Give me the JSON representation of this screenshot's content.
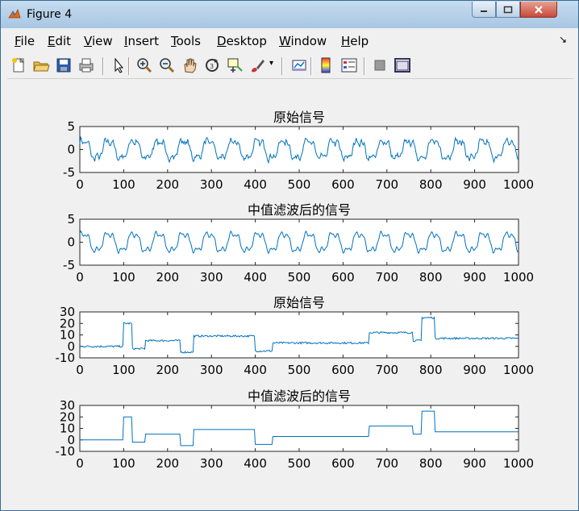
{
  "window": {
    "title": "Figure 4"
  },
  "menu": [
    {
      "key": "F",
      "rest": "ile"
    },
    {
      "key": "E",
      "rest": "dit"
    },
    {
      "key": "V",
      "rest": "iew"
    },
    {
      "key": "I",
      "rest": "nsert"
    },
    {
      "key": "T",
      "rest": "ools"
    },
    {
      "key": "D",
      "rest": "esktop"
    },
    {
      "key": "W",
      "rest": "indow"
    },
    {
      "key": "H",
      "rest": "elp"
    }
  ],
  "toolbar_icons": [
    "new-figure-icon",
    "open-file-icon",
    "save-icon",
    "print-icon",
    "pointer-icon",
    "zoom-in-icon",
    "zoom-out-icon",
    "pan-icon",
    "rotate-3d-icon",
    "data-cursor-icon",
    "brush-icon",
    "link-plot-icon",
    "colorbar-icon",
    "legend-icon",
    "hide-plot-tools-icon",
    "show-plot-tools-icon"
  ],
  "colors": {
    "line": "#0072bd",
    "axes_bg": "#ffffff",
    "figure_bg": "#f0f0f0"
  },
  "chart_data": [
    {
      "type": "line",
      "title": "原始信号",
      "xlim": [
        0,
        1000
      ],
      "ylim": [
        -5,
        5
      ],
      "xticks": [
        0,
        100,
        200,
        300,
        400,
        500,
        600,
        700,
        800,
        900,
        1000
      ],
      "yticks": [
        -5,
        0,
        5
      ],
      "signal": "periodic",
      "noisy": true
    },
    {
      "type": "line",
      "title": "中值滤波后的信号",
      "xlim": [
        0,
        1000
      ],
      "ylim": [
        -5,
        5
      ],
      "xticks": [
        0,
        100,
        200,
        300,
        400,
        500,
        600,
        700,
        800,
        900,
        1000
      ],
      "yticks": [
        -5,
        0,
        5
      ],
      "signal": "periodic",
      "noisy": false
    },
    {
      "type": "line",
      "title": "原始信号",
      "xlim": [
        0,
        1000
      ],
      "ylim": [
        -10,
        30
      ],
      "xticks": [
        0,
        100,
        200,
        300,
        400,
        500,
        600,
        700,
        800,
        900,
        1000
      ],
      "yticks": [
        -10,
        0,
        10,
        20,
        30
      ],
      "signal": "step",
      "noisy": true,
      "segments": [
        [
          0,
          100,
          0
        ],
        [
          100,
          120,
          20
        ],
        [
          120,
          150,
          -2
        ],
        [
          150,
          230,
          5
        ],
        [
          230,
          260,
          -5
        ],
        [
          260,
          400,
          9
        ],
        [
          400,
          440,
          -4
        ],
        [
          440,
          660,
          3
        ],
        [
          660,
          760,
          12
        ],
        [
          760,
          780,
          5
        ],
        [
          780,
          810,
          25
        ],
        [
          810,
          1000,
          7
        ]
      ]
    },
    {
      "type": "line",
      "title": "中值滤波后的信号",
      "xlim": [
        0,
        1000
      ],
      "ylim": [
        -10,
        30
      ],
      "xticks": [
        0,
        100,
        200,
        300,
        400,
        500,
        600,
        700,
        800,
        900,
        1000
      ],
      "yticks": [
        -10,
        0,
        10,
        20,
        30
      ],
      "signal": "step",
      "noisy": false,
      "segments": [
        [
          0,
          100,
          0
        ],
        [
          100,
          120,
          20
        ],
        [
          120,
          150,
          -2
        ],
        [
          150,
          230,
          5
        ],
        [
          230,
          260,
          -5
        ],
        [
          260,
          400,
          9
        ],
        [
          400,
          440,
          -4
        ],
        [
          440,
          660,
          3
        ],
        [
          660,
          760,
          12
        ],
        [
          760,
          780,
          5
        ],
        [
          780,
          810,
          25
        ],
        [
          810,
          1000,
          7
        ]
      ]
    }
  ]
}
